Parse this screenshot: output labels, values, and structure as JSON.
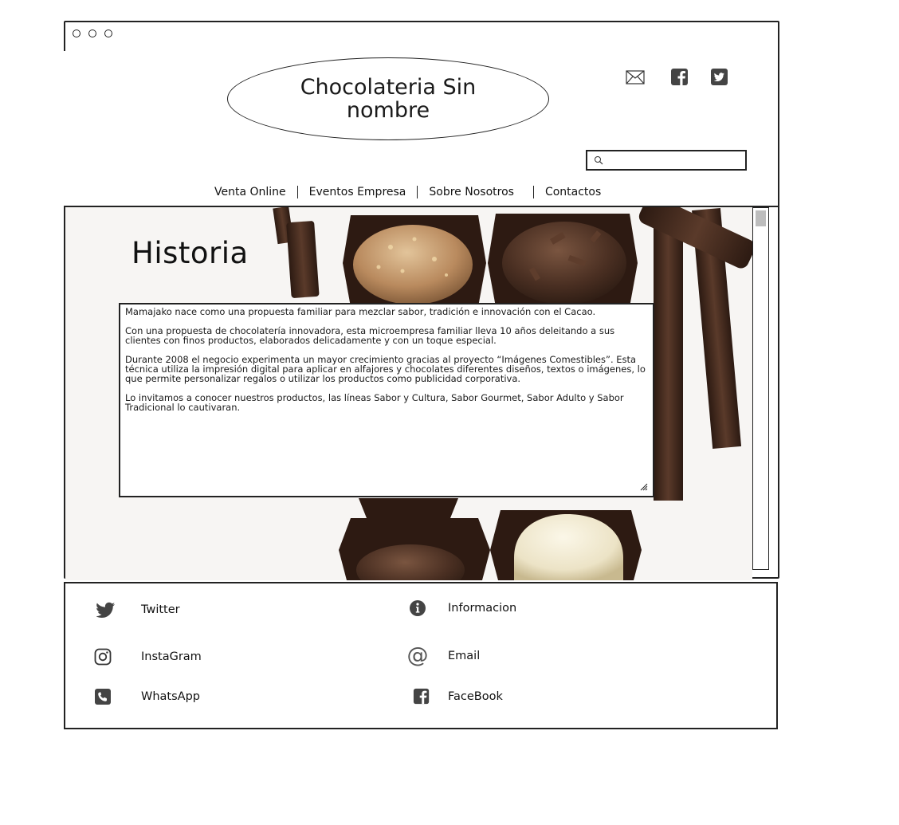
{
  "window": {
    "controls": [
      "close",
      "minimize",
      "maximize"
    ]
  },
  "header": {
    "brand": "Chocolateria Sin nombre",
    "social_icons": [
      "mail-icon",
      "facebook-icon",
      "twitter-icon"
    ],
    "search": {
      "placeholder": ""
    }
  },
  "nav": {
    "items": [
      {
        "label": "Venta Online"
      },
      {
        "label": "Eventos Empresa"
      },
      {
        "label": "Sobre Nosotros"
      },
      {
        "label": "Contactos"
      }
    ]
  },
  "main": {
    "title": "Historia",
    "paragraphs": [
      "Mamajako nace como una propuesta familiar para mezclar sabor, tradición e innovación con el Cacao.",
      "Con una propuesta de chocolatería innovadora, esta microempresa familiar lleva 10 años deleitando a sus clientes con finos productos, elaborados delicadamente y con un toque especial.",
      "Durante 2008 el negocio experimenta un mayor crecimiento gracias al proyecto “Imágenes Comestibles”. Esta técnica utiliza la impresión digital para aplicar en alfajores y chocolates diferentes diseños, textos o imágenes, lo que permite personalizar regalos o utilizar los productos como publicidad corporativa.",
      "Lo invitamos a conocer nuestros productos, las líneas Sabor y Cultura, Sabor Gourmet, Sabor Adulto y Sabor Tradicional lo cautivaran."
    ]
  },
  "footer": {
    "links": [
      {
        "label": "Twitter",
        "icon": "twitter-icon"
      },
      {
        "label": "InstaGram",
        "icon": "instagram-icon"
      },
      {
        "label": "WhatsApp",
        "icon": "phone-icon"
      },
      {
        "label": "Informacion",
        "icon": "info-icon"
      },
      {
        "label": "Email",
        "icon": "at-icon"
      },
      {
        "label": "FaceBook",
        "icon": "facebook-icon"
      }
    ]
  },
  "colors": {
    "ink": "#222222",
    "chocolate_dark": "#3a2418",
    "chocolate_milk": "#b98a5e",
    "white_choc": "#efe8d2"
  }
}
